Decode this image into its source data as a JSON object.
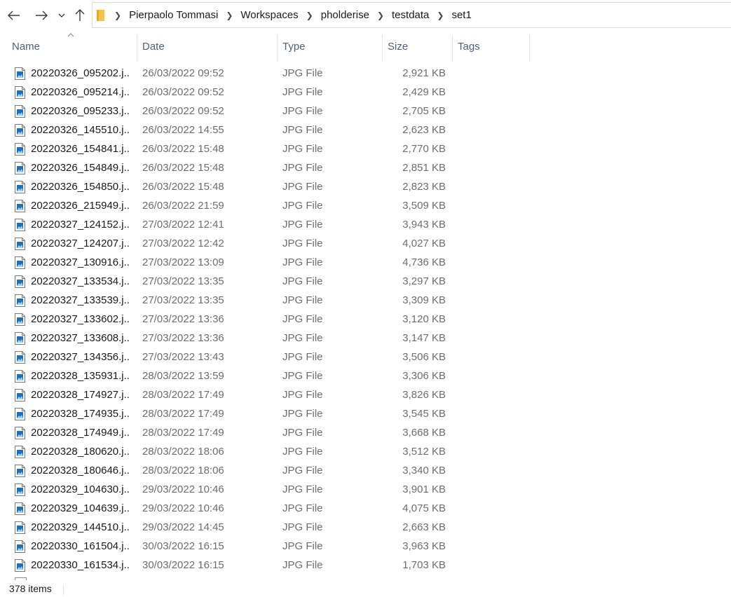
{
  "breadcrumb": [
    "Pierpaolo Tommasi",
    "Workspaces",
    "pholderise",
    "testdata",
    "set1"
  ],
  "columns": {
    "name": "Name",
    "date": "Date",
    "type": "Type",
    "size": "Size",
    "tags": "Tags"
  },
  "sort": {
    "column": "name",
    "direction": "ascending"
  },
  "files": [
    {
      "name": "20220326_095202.j...",
      "date": "26/03/2022 09:52",
      "type": "JPG File",
      "size": "2,921 KB"
    },
    {
      "name": "20220326_095214.j...",
      "date": "26/03/2022 09:52",
      "type": "JPG File",
      "size": "2,429 KB"
    },
    {
      "name": "20220326_095233.j...",
      "date": "26/03/2022 09:52",
      "type": "JPG File",
      "size": "2,705 KB"
    },
    {
      "name": "20220326_145510.j...",
      "date": "26/03/2022 14:55",
      "type": "JPG File",
      "size": "2,623 KB"
    },
    {
      "name": "20220326_154841.j...",
      "date": "26/03/2022 15:48",
      "type": "JPG File",
      "size": "2,770 KB"
    },
    {
      "name": "20220326_154849.j...",
      "date": "26/03/2022 15:48",
      "type": "JPG File",
      "size": "2,851 KB"
    },
    {
      "name": "20220326_154850.j...",
      "date": "26/03/2022 15:48",
      "type": "JPG File",
      "size": "2,823 KB"
    },
    {
      "name": "20220326_215949.j...",
      "date": "26/03/2022 21:59",
      "type": "JPG File",
      "size": "3,509 KB"
    },
    {
      "name": "20220327_124152.j...",
      "date": "27/03/2022 12:41",
      "type": "JPG File",
      "size": "3,943 KB"
    },
    {
      "name": "20220327_124207.j...",
      "date": "27/03/2022 12:42",
      "type": "JPG File",
      "size": "4,027 KB"
    },
    {
      "name": "20220327_130916.j...",
      "date": "27/03/2022 13:09",
      "type": "JPG File",
      "size": "4,736 KB"
    },
    {
      "name": "20220327_133534.j...",
      "date": "27/03/2022 13:35",
      "type": "JPG File",
      "size": "3,297 KB"
    },
    {
      "name": "20220327_133539.j...",
      "date": "27/03/2022 13:35",
      "type": "JPG File",
      "size": "3,309 KB"
    },
    {
      "name": "20220327_133602.j...",
      "date": "27/03/2022 13:36",
      "type": "JPG File",
      "size": "3,120 KB"
    },
    {
      "name": "20220327_133608.j...",
      "date": "27/03/2022 13:36",
      "type": "JPG File",
      "size": "3,147 KB"
    },
    {
      "name": "20220327_134356.j...",
      "date": "27/03/2022 13:43",
      "type": "JPG File",
      "size": "3,506 KB"
    },
    {
      "name": "20220328_135931.j...",
      "date": "28/03/2022 13:59",
      "type": "JPG File",
      "size": "3,306 KB"
    },
    {
      "name": "20220328_174927.j...",
      "date": "28/03/2022 17:49",
      "type": "JPG File",
      "size": "3,826 KB"
    },
    {
      "name": "20220328_174935.j...",
      "date": "28/03/2022 17:49",
      "type": "JPG File",
      "size": "3,545 KB"
    },
    {
      "name": "20220328_174949.j...",
      "date": "28/03/2022 17:49",
      "type": "JPG File",
      "size": "3,668 KB"
    },
    {
      "name": "20220328_180620.j...",
      "date": "28/03/2022 18:06",
      "type": "JPG File",
      "size": "3,512 KB"
    },
    {
      "name": "20220328_180646.j...",
      "date": "28/03/2022 18:06",
      "type": "JPG File",
      "size": "3,340 KB"
    },
    {
      "name": "20220329_104630.j...",
      "date": "29/03/2022 10:46",
      "type": "JPG File",
      "size": "3,901 KB"
    },
    {
      "name": "20220329_104639.j...",
      "date": "29/03/2022 10:46",
      "type": "JPG File",
      "size": "4,075 KB"
    },
    {
      "name": "20220329_144510.j...",
      "date": "29/03/2022 14:45",
      "type": "JPG File",
      "size": "2,663 KB"
    },
    {
      "name": "20220330_161504.j...",
      "date": "30/03/2022 16:15",
      "type": "JPG File",
      "size": "3,963 KB"
    },
    {
      "name": "20220330_161534.j...",
      "date": "30/03/2022 16:15",
      "type": "JPG File",
      "size": "1,703 KB"
    }
  ],
  "status": {
    "item_count": "378 items"
  },
  "icons": {
    "back": "back-arrow-icon",
    "forward": "forward-arrow-icon",
    "recent": "chevron-down-icon",
    "up": "up-arrow-icon",
    "folder": "folder-icon",
    "file": "image-file-icon"
  },
  "colors": {
    "header_text": "#4c607a",
    "secondary_text": "#6d6d6d",
    "folder": "#f4c542"
  }
}
